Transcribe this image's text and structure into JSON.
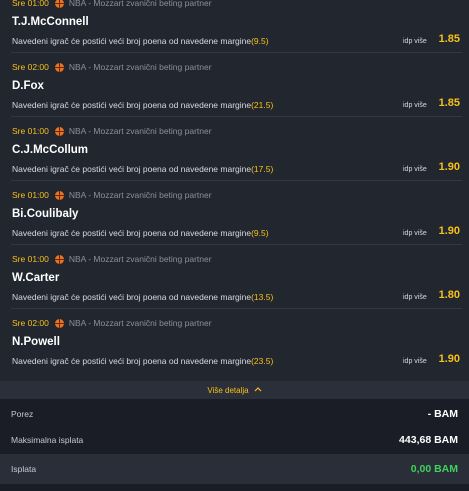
{
  "bets": [
    {
      "time": "Sre 01:00",
      "league": "NBA - Mozzart zvanični beting partner",
      "player": "T.J.McConnell",
      "description": "Navedeni igrač će postići veći broj poena od navedene margine",
      "margin": "(9.5)",
      "pick": "idp više",
      "odd": "1.85"
    },
    {
      "time": "Sre 02:00",
      "league": "NBA - Mozzart zvanični beting partner",
      "player": "D.Fox",
      "description": "Navedeni igrač će postići veći broj poena od navedene margine",
      "margin": "(21.5)",
      "pick": "idp više",
      "odd": "1.85"
    },
    {
      "time": "Sre 01:00",
      "league": "NBA - Mozzart zvanični beting partner",
      "player": "C.J.McCollum",
      "description": "Navedeni igrač će postići veći broj poena od navedene margine",
      "margin": "(17.5)",
      "pick": "idp više",
      "odd": "1.90"
    },
    {
      "time": "Sre 01:00",
      "league": "NBA - Mozzart zvanični beting partner",
      "player": "Bi.Coulibaly",
      "description": "Navedeni igrač će postići veći broj poena od navedene margine",
      "margin": "(9.5)",
      "pick": "idp više",
      "odd": "1.90"
    },
    {
      "time": "Sre 01:00",
      "league": "NBA - Mozzart zvanični beting partner",
      "player": "W.Carter",
      "description": "Navedeni igrač će postići veći broj poena od navedene margine",
      "margin": "(13.5)",
      "pick": "idp više",
      "odd": "1.80"
    },
    {
      "time": "Sre 02:00",
      "league": "NBA - Mozzart zvanični beting partner",
      "player": "N.Powell",
      "description": "Navedeni igrač će postići veći broj poena od navedene margine",
      "margin": "(23.5)",
      "pick": "idp više",
      "odd": "1.90"
    }
  ],
  "more_details": {
    "label": "Više detalja",
    "icon": "chevron-up-icon"
  },
  "summary": {
    "tax_label": "Porez",
    "tax_value": "- BAM",
    "max_payout_label": "Maksimalna isplata",
    "max_payout_value": "443,68 BAM",
    "payout_label": "Isplata",
    "payout_value": "0,00 BAM"
  },
  "colors": {
    "accent": "#f5c11b",
    "payout": "#3fd25c",
    "background": "#22262f"
  }
}
